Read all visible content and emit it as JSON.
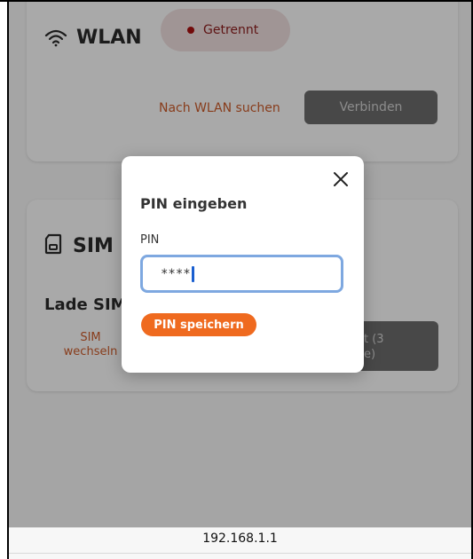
{
  "wlan": {
    "title": "WLAN",
    "status": "Getrennt",
    "status_color": "#a80f0f",
    "scan_link": "Nach WLAN suchen",
    "connect_button": "Verbinden"
  },
  "sim": {
    "title": "SIM",
    "loading_text": "Lade SIM",
    "switch_link": "SIM wechseln",
    "right_button_partial": "t (3\ne)"
  },
  "modal": {
    "title": "PIN eingeben",
    "pin_label": "PIN",
    "pin_value": "****",
    "save_button": "PIN speichern"
  },
  "browser": {
    "url": "192.168.1.1"
  },
  "icons": {
    "wifi": "wifi-icon",
    "sim": "sim-card-icon",
    "close": "close-icon"
  },
  "colors": {
    "accent": "#ef6a1f",
    "link": "#c95a2a",
    "input_focus": "#7ea8e0"
  }
}
